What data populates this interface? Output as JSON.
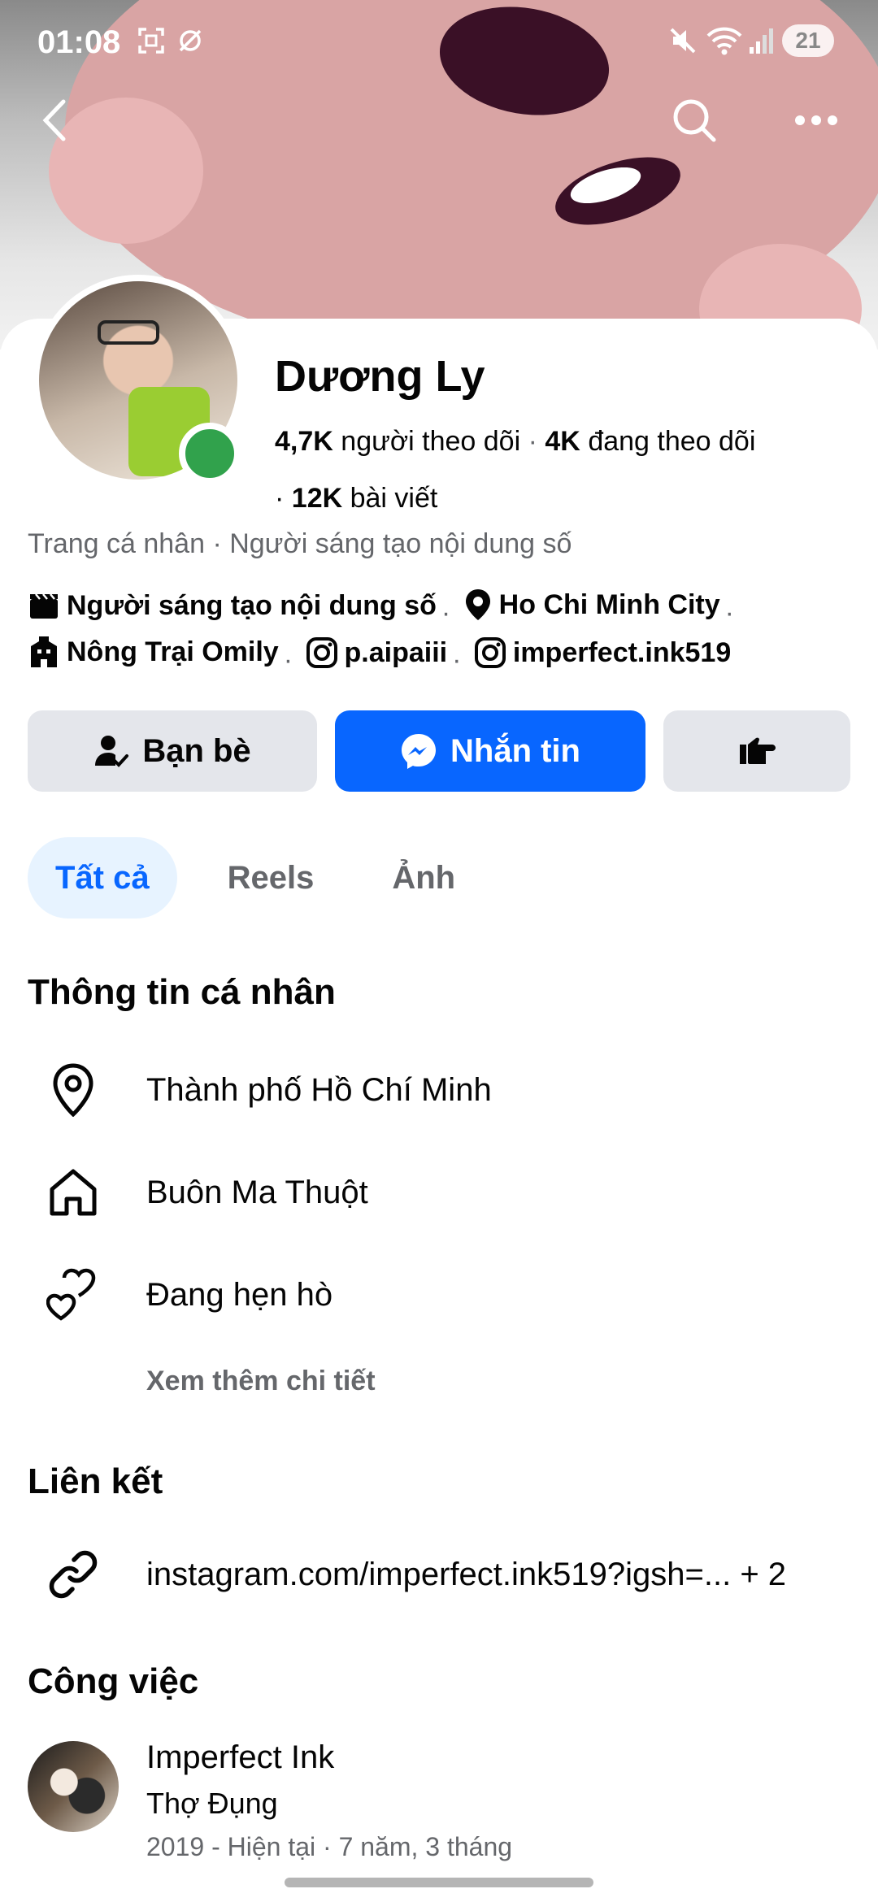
{
  "status_bar": {
    "time": "01:08",
    "battery": "21"
  },
  "profile": {
    "name": "Dương Ly",
    "followers_count": "4,7K",
    "followers_label": "người theo dõi",
    "following_count": "4K",
    "following_label": "đang theo dõi",
    "posts_count": "12K",
    "posts_label": "bài viết",
    "category": "Trang cá nhân · Người sáng tạo nội dung số"
  },
  "meta": {
    "creator": "Người sáng tạo nội dung số",
    "city": "Ho Chi Minh City",
    "farm": "Nông Trại Omily",
    "ig1": "p.aipaiii",
    "ig2": "imperfect.ink519"
  },
  "actions": {
    "friends": "Bạn bè",
    "message": "Nhắn tin"
  },
  "tabs": [
    {
      "label": "Tất cả"
    },
    {
      "label": "Reels"
    },
    {
      "label": "Ảnh"
    }
  ],
  "personal_info": {
    "title": "Thông tin cá nhân",
    "items": [
      {
        "icon": "location-pin-icon",
        "text": "Thành phố Hồ Chí Minh"
      },
      {
        "icon": "home-icon",
        "text": "Buôn Ma Thuột"
      },
      {
        "icon": "hearts-icon",
        "text": "Đang hẹn hò"
      }
    ],
    "see_more": "Xem thêm chi tiết"
  },
  "links": {
    "title": "Liên kết",
    "url": "instagram.com/imperfect.ink519?igsh=... + 2"
  },
  "work": {
    "title": "Công việc",
    "company": "Imperfect Ink",
    "role": "Thợ Đụng",
    "dates": "2019 - Hiện tại · 7 năm, 3 tháng"
  },
  "colors": {
    "brand": "#0866ff",
    "online": "#31a24c",
    "secondary_text": "#65676b",
    "button_grey": "#e4e6eb"
  }
}
